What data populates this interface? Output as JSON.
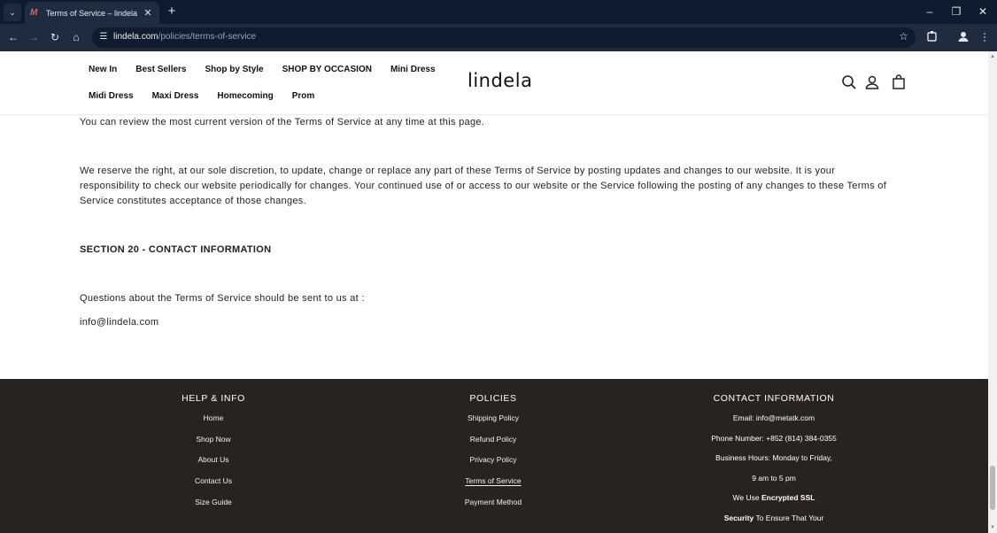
{
  "browser": {
    "tab_title": "Terms of Service – lindela",
    "url_domain": "lindela.com",
    "url_path": "/policies/terms-of-service"
  },
  "header": {
    "menu_row1": [
      "New In",
      "Best Sellers",
      "Shop by Style",
      "SHOP BY OCCASION",
      "Mini Dress"
    ],
    "menu_row2": [
      "Midi Dress",
      "Maxi Dress",
      "Homecoming",
      "Prom"
    ],
    "logo": "lindela"
  },
  "content": {
    "p1": "You can review the most current version of the Terms of Service at any time at this page.",
    "p2": "We reserve the right, at our sole discretion, to update, change or replace any part of these Terms of Service by posting updates and changes to our website. It is your responsibility to check our website periodically for changes. Your continued use of or access to our website or the Service following the posting of any changes to these Terms of Service constitutes acceptance of those changes.",
    "section_heading": "SECTION 20 - CONTACT INFORMATION",
    "p3": "Questions about the Terms of Service should be sent to us at :",
    "email": "info@lindela.com"
  },
  "footer": {
    "help": {
      "title": "HELP & INFO",
      "links": [
        "Home",
        "Shop Now",
        "About Us",
        "Contact Us",
        "Size Guide"
      ]
    },
    "policies": {
      "title": "POLICIES",
      "links": [
        "Shipping Policy",
        "Refund Policy",
        "Privacy Policy",
        "Terms of Service",
        "Payment Method"
      ]
    },
    "contact": {
      "title": "CONTACT INFORMATION",
      "email": "Email:  info@metatk.com",
      "phone": "Phone Number:  +852 (814) 384-0355",
      "hours": "Business Hours: Monday to Friday,",
      "time": "9 am to 5 pm",
      "ssl_pre": "We Use ",
      "ssl_bold": "Encrypted SSL",
      "sec_bold": "Security",
      "sec_post": " To Ensure That Your"
    }
  }
}
